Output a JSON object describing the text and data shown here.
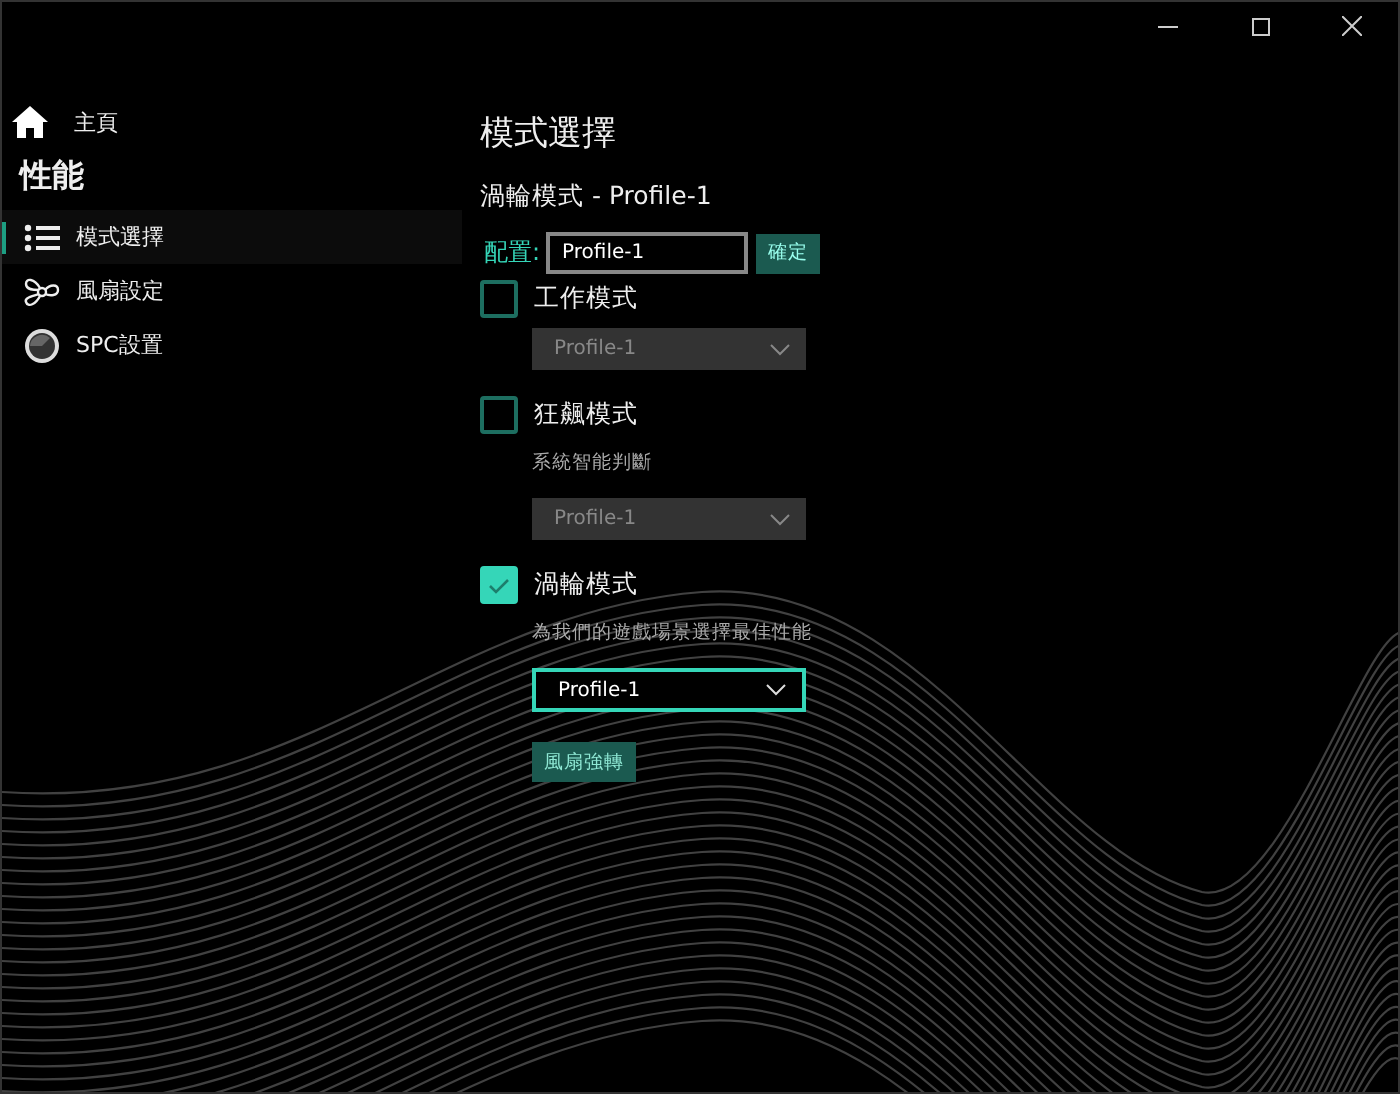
{
  "sidebar": {
    "home": "主頁",
    "section": "性能",
    "items": [
      {
        "label": "模式選擇",
        "kind": "list",
        "selected": true
      },
      {
        "label": "風扇設定",
        "kind": "fan",
        "selected": false
      },
      {
        "label": "SPC設置",
        "kind": "gauge",
        "selected": false
      }
    ]
  },
  "main": {
    "title": "模式選擇",
    "subtitle": "渦輪模式 - Profile-1",
    "config": {
      "label": "配置:",
      "value": "Profile-1",
      "button": "確定"
    },
    "modes": [
      {
        "label": "工作模式",
        "checked": false,
        "dropdown": {
          "value": "Profile-1",
          "disabled": true
        }
      },
      {
        "label": "狂飆模式",
        "checked": false,
        "description": "系統智能判斷",
        "dropdown": {
          "value": "Profile-1",
          "disabled": true
        }
      },
      {
        "label": "渦輪模式",
        "checked": true,
        "description": "為我們的遊戲場景選擇最佳性能",
        "dropdown": {
          "value": "Profile-1",
          "disabled": false
        }
      }
    ],
    "fan_button": "風扇強轉"
  }
}
